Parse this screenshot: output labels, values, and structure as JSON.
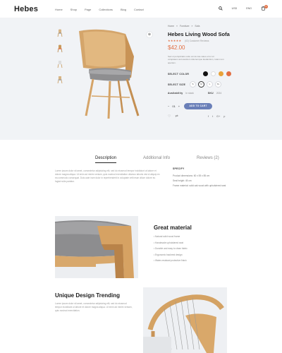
{
  "brand": {
    "logo": "Hebes"
  },
  "nav": [
    "Home",
    "Shop",
    "Page",
    "Collections",
    "Blog",
    "Contact"
  ],
  "header": {
    "currency": "USD",
    "language": "ENG",
    "cart_count": "0"
  },
  "breadcrumb": [
    "Home",
    "Furniture",
    "Sofa"
  ],
  "product": {
    "title": "Hebes Living Wood Sofa",
    "stars": "★★★★★",
    "reviews": "(02) Customer Reviews",
    "price": "$42.00",
    "description": "Sed ut perspiciatis unde omnis iste natus error sit voluptatem accusantium doloremque laudantium, totam rem aperiam.",
    "select_color_label": "SELECT COLOR",
    "colors": [
      "#111111",
      "#ffffff",
      "#e8a23a",
      "#e26f43"
    ],
    "select_size_label": "SELECT SIZE",
    "sizes": [
      "S",
      "M",
      "L",
      "XL"
    ],
    "availability_label": "Availability",
    "availability_value": "In stock",
    "sku_label": "SKU",
    "sku_value": "2024",
    "quantity": "01",
    "add_to_cart_label": "ADD TO CART",
    "share_icons": [
      "f",
      "t",
      "G+",
      "p"
    ]
  },
  "tabs": [
    "Description",
    "Additional Info",
    "Reviews (2)"
  ],
  "description_text": "Lorem ipsum dolor sit amet, consectetur adipisicing elit, sed do eiusmod tempor incididunt ut labore et dolore magna aliqua. Ut enim ad minim veniam, quis nostrud exercitation ullamco laboris nisi ut aliquip ex ea commodo consequat. Duis aute irure dolor in reprehenderit in voluptate velit esse cillum dolore eu fugiat nulla pariatur.",
  "specs": {
    "heading": "SPECIFY",
    "items": [
      "Product dimensions: 60 x 55 x 85 cm",
      "Seat height: 45 cm",
      "Frame material: solid oak wood with upholstered seat"
    ]
  },
  "feature1": {
    "title": "Great material",
    "items": [
      "Natural solid wood frame",
      "Handmade upholstered seat",
      "Durable and easy to clean fabric",
      "Ergonomic backrest design",
      "Water-resistant protective finish"
    ]
  },
  "feature2": {
    "title": "Unique Design Trending",
    "text": "Lorem ipsum dolor sit amet, consectetur adipisicing elit, sed do eiusmod tempor incididunt ut labore et dolore magna aliqua. Ut enim ad minim veniam, quis nostrud exercitation."
  }
}
